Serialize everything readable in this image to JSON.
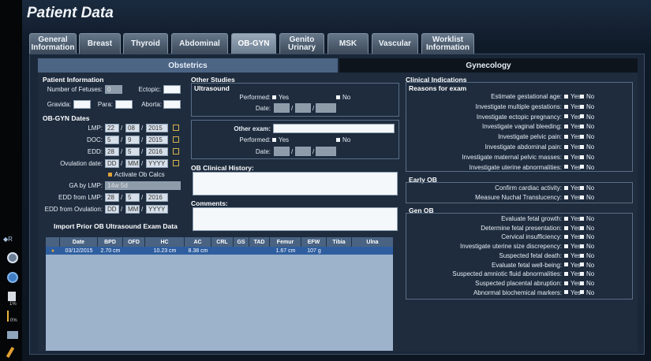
{
  "title": "Patient Data",
  "tabs": [
    "General Information",
    "Breast",
    "Thyroid",
    "Abdominal",
    "OB-GYN",
    "Genito Urinary",
    "MSK",
    "Vascular",
    "Worklist Information"
  ],
  "active_tab": "OB-GYN",
  "subtabs": {
    "obstetrics": "Obstetrics",
    "gynecology": "Gynecology"
  },
  "patient_info": {
    "header": "Patient Information",
    "num_fetuses_label": "Number of Fetuses:",
    "num_fetuses_value": "0",
    "ectopic_label": "Ectopic:",
    "gravida_label": "Gravida:",
    "para_label": "Para:",
    "aborta_label": "Aborta:"
  },
  "obgyn_dates": {
    "header": "OB-GYN Dates",
    "lmp_label": "LMP:",
    "lmp": [
      "22",
      "08",
      "2015"
    ],
    "doc_label": "DOC:",
    "doc": [
      "5",
      "9",
      "2015"
    ],
    "edd_label": "EDD:",
    "edd": [
      "28",
      "5",
      "2016"
    ],
    "ovulation_label": "Ovulation date:",
    "ovulation": [
      "DD",
      "MM",
      "YYYY"
    ],
    "activate_label": "Activate Ob Calcs",
    "ga_label": "GA by LMP:",
    "ga_value": "14w 5d",
    "edd_lmp_label": "EDD from LMP:",
    "edd_lmp": [
      "28",
      "5",
      "2016"
    ],
    "edd_ovulation_label": "EDD from Ovulation:",
    "edd_ovulation": [
      "DD",
      "MM",
      "YYYY"
    ]
  },
  "other_studies": {
    "header": "Other Studies",
    "ultrasound_header": "Ultrasound",
    "performed_label": "Performed:",
    "yes": "Yes",
    "no": "No",
    "date_label": "Date:",
    "other_exam_label": "Other exam:"
  },
  "clinical_history_label": "OB Clinical History:",
  "comments_label": "Comments:",
  "import_label": "Import Prior OB Ultrasound Exam Data",
  "grid": {
    "columns": [
      "",
      "Date",
      "BPD",
      "OFD",
      "HC",
      "AC",
      "CRL",
      "GS",
      "TAD",
      "Femur",
      "EFW",
      "Tibia",
      "Ulna"
    ],
    "rows": [
      [
        "",
        "03/12/2015",
        "2.70 cm",
        "",
        "10.23 cm",
        "8.38 cm",
        "",
        "",
        "",
        "1.67 cm",
        "107 g",
        "",
        ""
      ]
    ]
  },
  "clinical": {
    "header": "Clinical Indications",
    "reasons_header": "Reasons for exam",
    "yes": "Yes",
    "no": "No",
    "reasons": [
      "Estimate gestational age:",
      "Investigate multiple gestations:",
      "Investigate ectopic pregnancy:",
      "Investigate vaginal bleeding:",
      "Investigate pelvic pain:",
      "Investigate abdominal pain:",
      "Investigate maternal pelvic masses:",
      "Investigate uterine abnormalities:"
    ],
    "early_ob_header": "Early OB",
    "early_ob": [
      "Confirm cardiac activity:",
      "Measure Nuchal Translucency:"
    ],
    "gen_ob_header": "Gen OB",
    "gen_ob": [
      "Evaluate fetal growth:",
      "Determine fetal presentation:",
      "Cervical insufficiency:",
      "Investigate uterine size discrepency:",
      "Suspected fetal death:",
      "Evaluate fetal well-being:",
      "Suspected amniotic fluid abnormalities:",
      "Suspected placental abruption:",
      "Abnormal biochemical markers:"
    ]
  },
  "sidebar": {
    "r_label": "R",
    "vol1": "1%",
    "vol2": "0%"
  }
}
